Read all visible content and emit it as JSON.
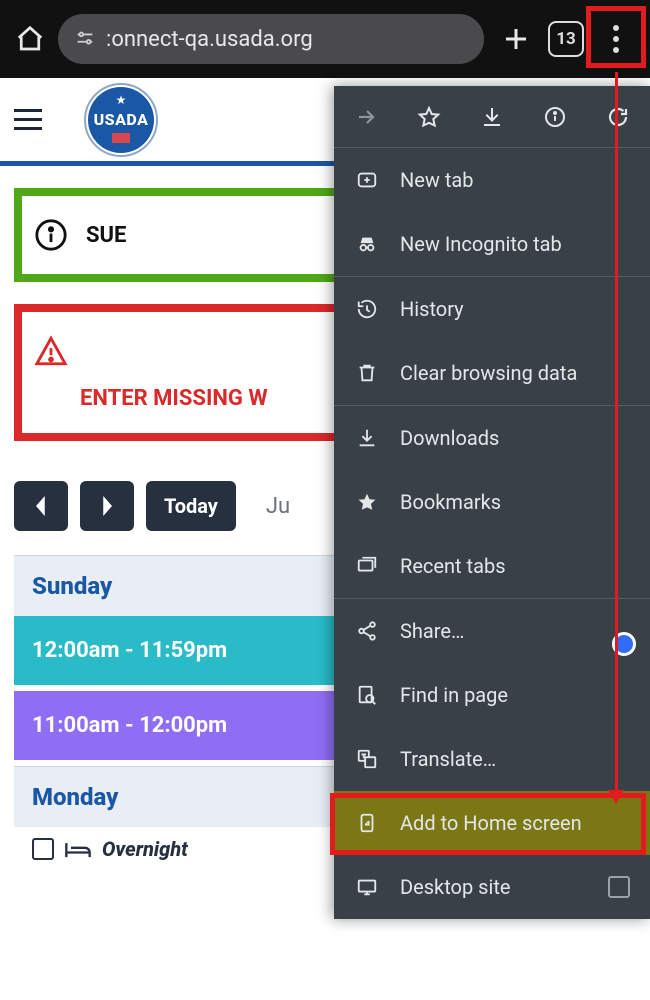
{
  "browser": {
    "url_visible": ":onnect-qa.usada.org",
    "tab_count": "13"
  },
  "app": {
    "logo_text": "USADA"
  },
  "banners": {
    "submit_label": "SUE",
    "missing_label": "ENTER MISSING W"
  },
  "calendar": {
    "today_label": "Today",
    "month_fragment": "Ju",
    "days": {
      "sunday": "Sunday",
      "monday": "Monday"
    },
    "events": {
      "e1": "12:00am - 11:59pm",
      "e2": "11:00am - 12:00pm"
    },
    "overnight_label": "Overnight"
  },
  "menu": {
    "new_tab": "New tab",
    "incognito": "New Incognito tab",
    "history": "History",
    "clear": "Clear browsing data",
    "downloads": "Downloads",
    "bookmarks": "Bookmarks",
    "recent": "Recent tabs",
    "share": "Share…",
    "find": "Find in page",
    "translate": "Translate…",
    "add_home": "Add to Home screen",
    "desktop": "Desktop site"
  }
}
